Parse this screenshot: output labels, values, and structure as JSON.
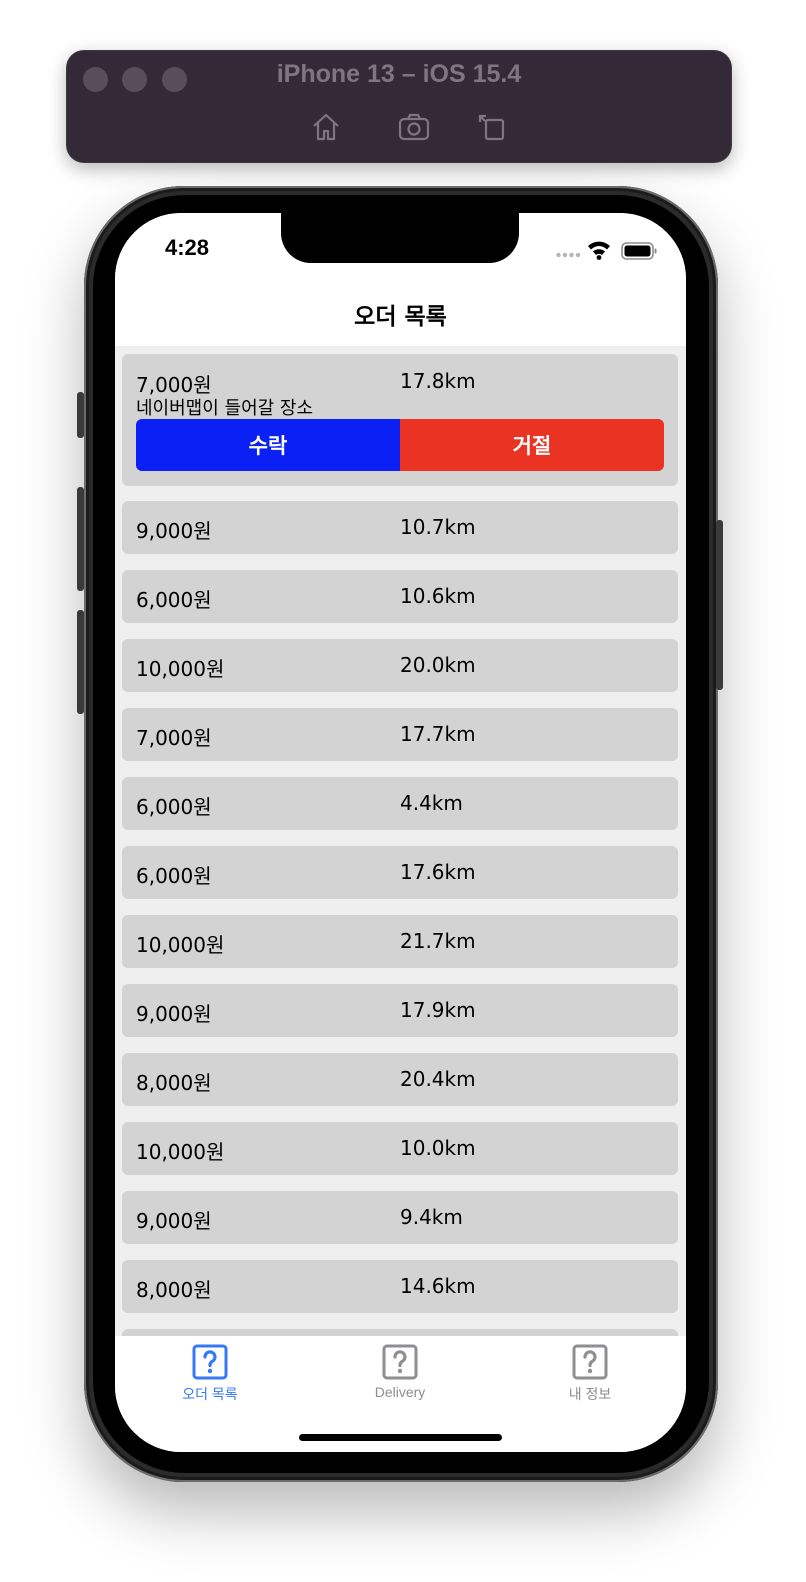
{
  "simulator": {
    "title": "iPhone 13 – iOS 15.4",
    "tools": [
      "home-icon",
      "screenshot-icon",
      "rotate-icon"
    ]
  },
  "status_bar": {
    "time": "4:28",
    "icons": [
      "signal-dots-icon",
      "wifi-icon",
      "battery-icon"
    ]
  },
  "nav": {
    "title": "오더 목록"
  },
  "expanded_order": {
    "price": "7,000원",
    "distance": "17.8km",
    "address": "네이버맵이 들어갈 장소",
    "accept_label": "수락",
    "reject_label": "거절"
  },
  "orders": [
    {
      "price": "9,000원",
      "distance": "10.7km"
    },
    {
      "price": "6,000원",
      "distance": "10.6km"
    },
    {
      "price": "10,000원",
      "distance": "20.0km"
    },
    {
      "price": "7,000원",
      "distance": "17.7km"
    },
    {
      "price": "6,000원",
      "distance": "4.4km"
    },
    {
      "price": "6,000원",
      "distance": "17.6km"
    },
    {
      "price": "10,000원",
      "distance": "21.7km"
    },
    {
      "price": "9,000원",
      "distance": "17.9km"
    },
    {
      "price": "8,000원",
      "distance": "20.4km"
    },
    {
      "price": "10,000원",
      "distance": "10.0km"
    },
    {
      "price": "9,000원",
      "distance": "9.4km"
    },
    {
      "price": "8,000원",
      "distance": "14.6km"
    }
  ],
  "tabs": [
    {
      "label": "오더 목록",
      "icon": "question-icon",
      "active": true
    },
    {
      "label": "Delivery",
      "icon": "question-icon",
      "active": false
    },
    {
      "label": "내 정보",
      "icon": "question-icon",
      "active": false
    }
  ],
  "colors": {
    "accept": "#0a20f5",
    "reject": "#ea3323",
    "card": "#d3d3d3",
    "tab_active": "#3478f6",
    "tab_inactive": "#8e8e93"
  }
}
